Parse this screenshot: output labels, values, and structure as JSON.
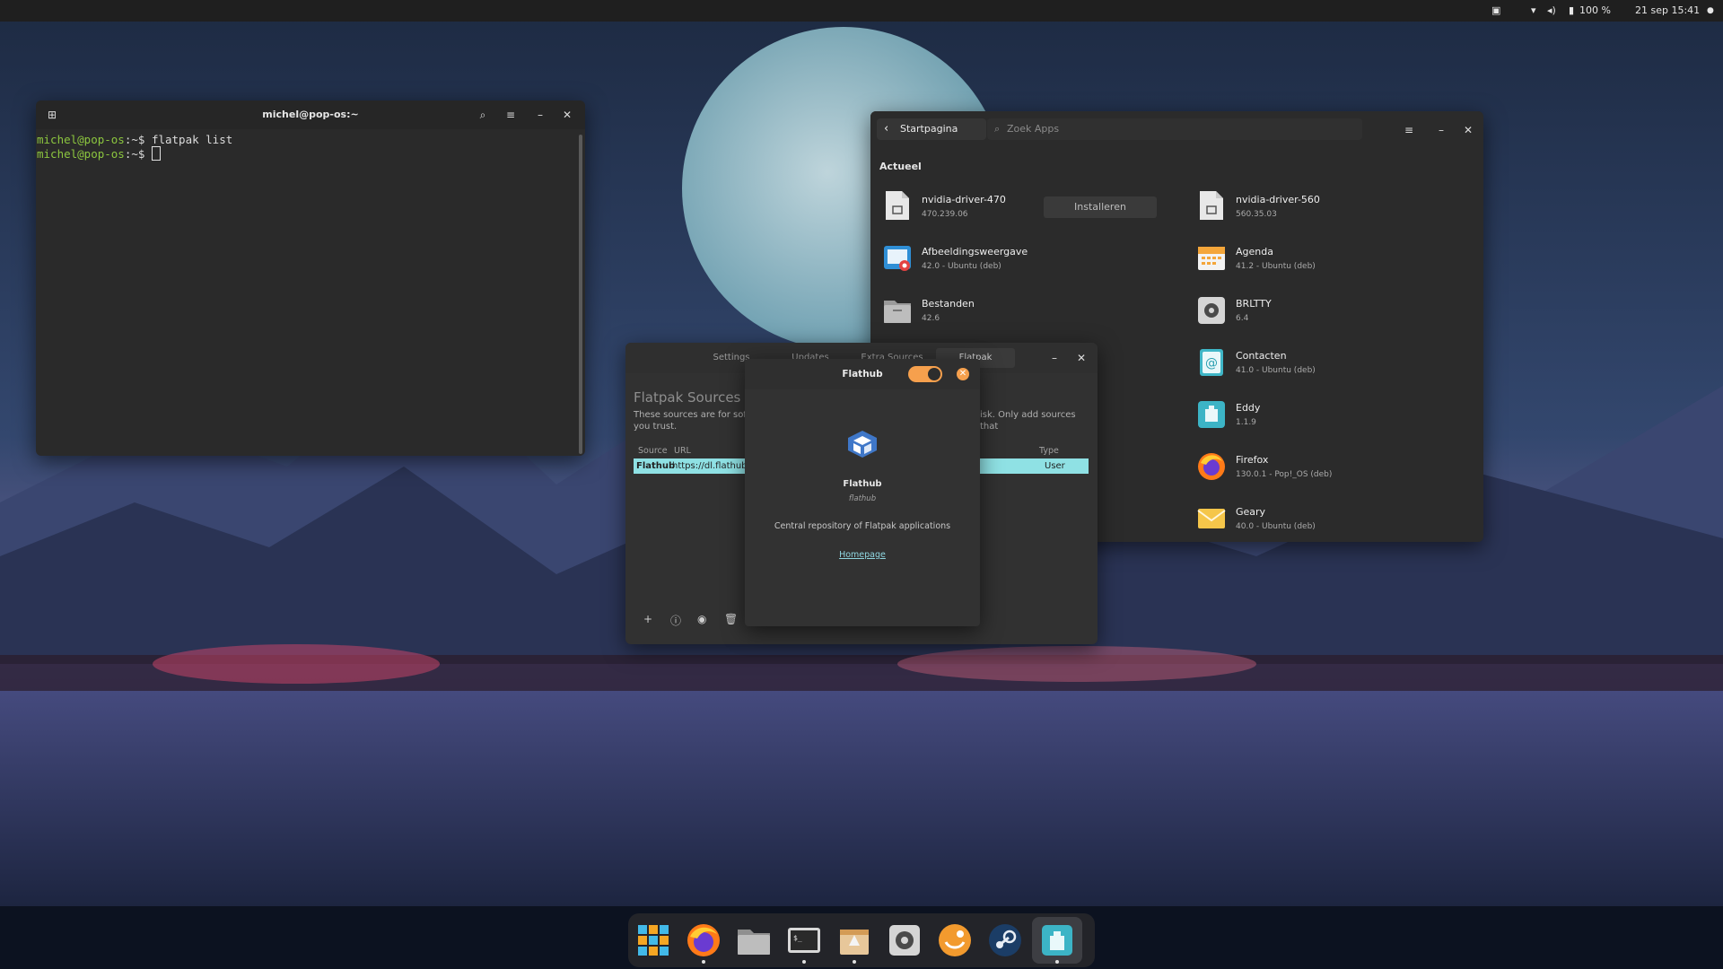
{
  "topbar": {
    "battery": "100 %",
    "datetime": "21 sep  15:41",
    "icons": [
      "notification-icon",
      "wifi-icon",
      "volume-icon",
      "battery-icon",
      "status-dot-icon"
    ]
  },
  "terminal": {
    "title": "michel@pop-os:~",
    "lines": [
      {
        "user": "michel@pop-os",
        "sep": ":~$ ",
        "cmd": "flatpak list"
      },
      {
        "user": "michel@pop-os",
        "sep": ":~$ ",
        "cmd": ""
      }
    ]
  },
  "store": {
    "back_label": "Startpagina",
    "search_placeholder": "Zoek Apps",
    "section": "Actueel",
    "install_label": "Installeren",
    "apps_left": [
      {
        "name": "nvidia-driver-470",
        "sub": "470.239.06",
        "icon": "driver-icon"
      },
      {
        "name": "Afbeeldingsweergave",
        "sub": "42.0 - Ubuntu (deb)",
        "icon": "image-viewer-icon"
      },
      {
        "name": "Bestanden",
        "sub": "42.6",
        "icon": "files-icon"
      }
    ],
    "apps_right": [
      {
        "name": "nvidia-driver-560",
        "sub": "560.35.03",
        "icon": "driver-icon"
      },
      {
        "name": "Agenda",
        "sub": "41.2 - Ubuntu (deb)",
        "icon": "calendar-icon"
      },
      {
        "name": "BRLTTY",
        "sub": "6.4",
        "icon": "gear-icon"
      },
      {
        "name": "Contacten",
        "sub": "41.0 - Ubuntu (deb)",
        "icon": "contacts-icon"
      },
      {
        "name": "Eddy",
        "sub": "1.1.9",
        "icon": "eddy-icon"
      },
      {
        "name": "Firefox",
        "sub": "130.0.1 - Pop!_OS (deb)",
        "icon": "firefox-icon"
      },
      {
        "name": "Geary",
        "sub": "40.0 - Ubuntu (deb)",
        "icon": "mail-icon"
      }
    ]
  },
  "repoman": {
    "tabs": [
      "Settings",
      "Updates",
      "Extra Sources",
      "Flatpak"
    ],
    "active_tab": "Flatpak",
    "title": "Flatpak Sources",
    "desc_left": "These sources are for soft",
    "desc_right": "isk. Only add sources that",
    "desc_line2": "you trust.",
    "col_source": "Source",
    "col_url": "URL",
    "col_type": "Type",
    "row": {
      "source": "Flathub",
      "url": "https://dl.flathub",
      "type": "User"
    }
  },
  "dialog": {
    "title": "Flathub",
    "enabled": true,
    "name": "Flathub",
    "id": "flathub",
    "description": "Central repository of Flatpak applications",
    "link": "Homepage"
  },
  "dock": {
    "apps": [
      "app-grid-icon",
      "firefox-icon",
      "files-icon",
      "terminal-icon",
      "store-icon",
      "settings-icon",
      "hexchat-icon",
      "steam-icon",
      "eddy-icon"
    ]
  },
  "colors": {
    "accent": "#f6a04d",
    "selection": "#8fe1e4",
    "prompt": "#8cc63f"
  }
}
